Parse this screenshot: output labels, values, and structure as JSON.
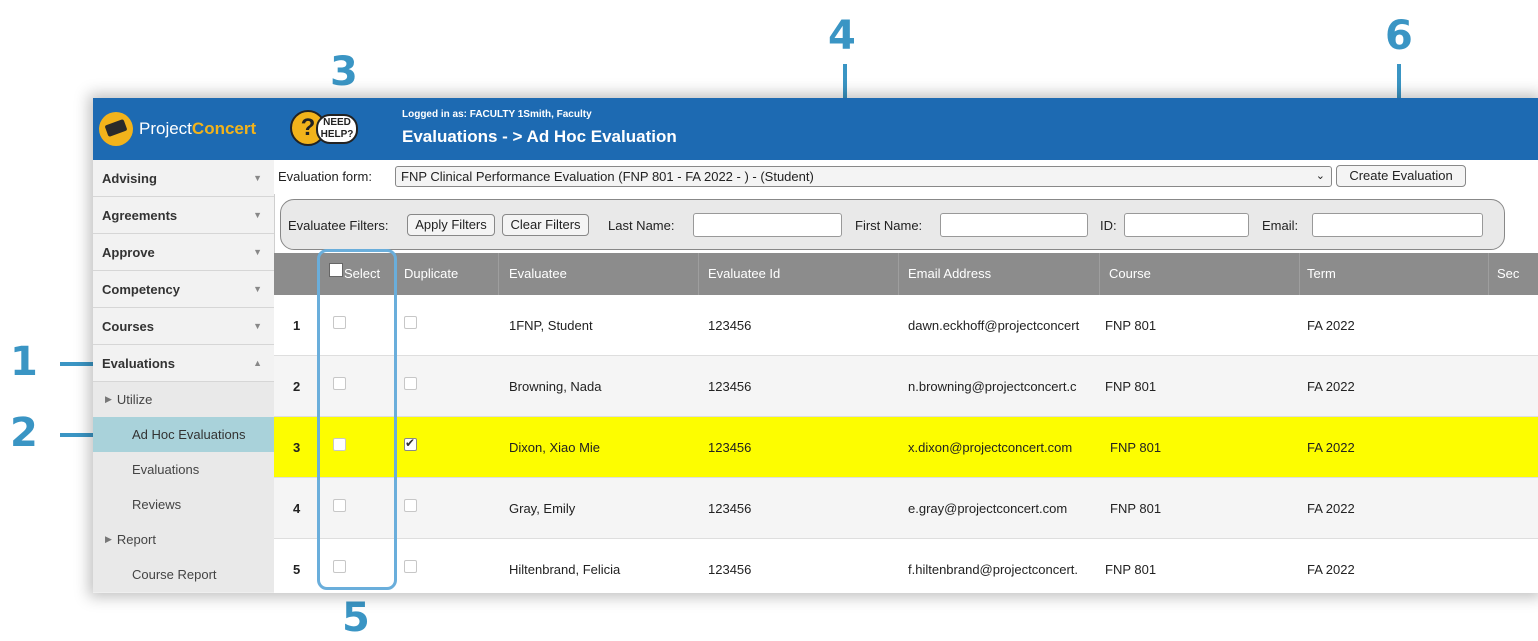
{
  "annotations": {
    "n1": "1",
    "n2": "2",
    "n3": "3",
    "n4": "4",
    "n5": "5",
    "n6": "6"
  },
  "brand": {
    "part1": "Project",
    "part2": "Concert"
  },
  "help": {
    "glyph": "?",
    "line1": "NEED",
    "line2": "HELP?"
  },
  "header": {
    "logged_in": "Logged in as: FACULTY 1Smith, Faculty",
    "title": "Evaluations - > Ad Hoc Evaluation"
  },
  "sidebar": {
    "items": [
      {
        "label": "Advising"
      },
      {
        "label": "Agreements"
      },
      {
        "label": "Approve"
      },
      {
        "label": "Competency"
      },
      {
        "label": "Courses"
      },
      {
        "label": "Evaluations"
      }
    ],
    "sub": {
      "utilize": "Utilize",
      "adhoc": "Ad Hoc Evaluations",
      "evaluations": "Evaluations",
      "reviews": "Reviews",
      "report": "Report",
      "course_report": "Course Report"
    }
  },
  "form": {
    "label": "Evaluation form:",
    "selected": "FNP Clinical Performance Evaluation (FNP 801 - FA 2022 - ) - (Student)",
    "create_button": "Create Evaluation"
  },
  "filters": {
    "label": "Evaluatee Filters:",
    "apply": "Apply Filters",
    "clear": "Clear Filters",
    "last_name": "Last Name:",
    "first_name": "First Name:",
    "id": "ID:",
    "email": "Email:"
  },
  "table": {
    "headers": {
      "select": "Select",
      "duplicate": "Duplicate",
      "evaluatee": "Evaluatee",
      "evaluatee_id": "Evaluatee Id",
      "email": "Email Address",
      "course": "Course",
      "term": "Term",
      "sec": "Sec"
    },
    "rows": [
      {
        "num": "1",
        "select": false,
        "duplicate": false,
        "name": "1FNP, Student",
        "id": "123456",
        "email": "dawn.eckhoff@projectconcert",
        "course": "FNP 801",
        "term": "FA 2022"
      },
      {
        "num": "2",
        "select": false,
        "duplicate": false,
        "name": "Browning, Nada",
        "id": "123456",
        "email": "n.browning@projectconcert.c",
        "course": "FNP 801",
        "term": "FA 2022"
      },
      {
        "num": "3",
        "select": false,
        "duplicate": true,
        "name": "Dixon, Xiao Mie",
        "id": "123456",
        "email": "x.dixon@projectconcert.com",
        "course": "FNP 801",
        "term": "FA 2022"
      },
      {
        "num": "4",
        "select": false,
        "duplicate": false,
        "name": "Gray, Emily",
        "id": "123456",
        "email": "e.gray@projectconcert.com",
        "course": "FNP 801",
        "term": "FA 2022"
      },
      {
        "num": "5",
        "select": false,
        "duplicate": false,
        "name": "Hiltenbrand, Felicia",
        "id": "123456",
        "email": "f.hiltenbrand@projectconcert.",
        "course": "FNP 801",
        "term": "FA 2022"
      }
    ]
  },
  "colors": {
    "header_blue": "#1d6ab2",
    "annotation_blue": "#3a95c4",
    "highlight_yellow": "#fdfd00",
    "active_nav": "#a9d2da"
  }
}
